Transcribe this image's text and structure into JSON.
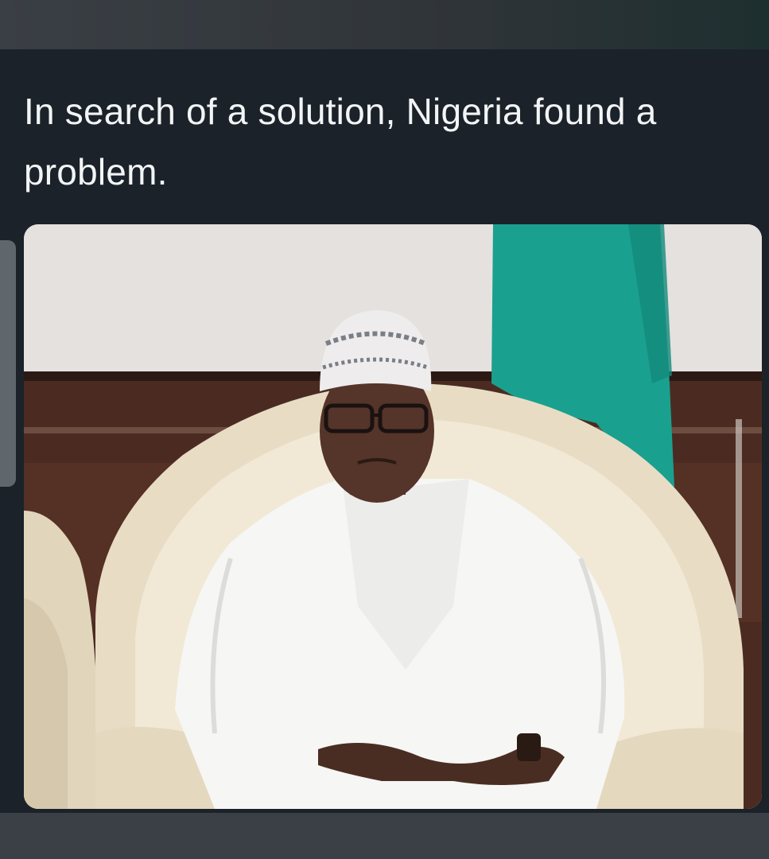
{
  "post": {
    "text": "In search of a solution, Nigeria found a problem."
  },
  "image": {
    "subject": "man in white kaftan and embroidered cap seated on cream armchair",
    "flag_color": "#1aa08f",
    "wall_color": "#e6e3e1",
    "panel_color": "#4a2a20",
    "chair_color": "#e8ddc4",
    "robe_color": "#f6f6f4"
  }
}
